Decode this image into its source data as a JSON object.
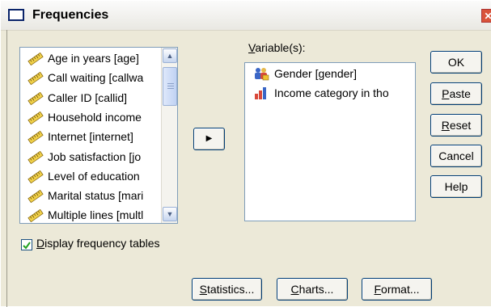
{
  "dialog": {
    "title": "Frequencies",
    "close_glyph": "✕"
  },
  "source_list": {
    "items": [
      {
        "label": "Age in years [age]",
        "icon": "scale-ruler-icon"
      },
      {
        "label": "Call waiting [callwa",
        "icon": "scale-ruler-icon"
      },
      {
        "label": "Caller ID [callid]",
        "icon": "scale-ruler-icon"
      },
      {
        "label": "Household income",
        "icon": "scale-ruler-icon"
      },
      {
        "label": "Internet [internet]",
        "icon": "scale-ruler-icon"
      },
      {
        "label": "Job satisfaction [jo",
        "icon": "scale-ruler-icon"
      },
      {
        "label": "Level of education",
        "icon": "scale-ruler-icon"
      },
      {
        "label": "Marital status [mari",
        "icon": "scale-ruler-icon"
      },
      {
        "label": "Multiple lines [multl",
        "icon": "scale-ruler-icon"
      }
    ],
    "scroll_up_glyph": "▲",
    "scroll_down_glyph": "▼"
  },
  "move_button": {
    "glyph": "▶"
  },
  "variables": {
    "label_first": "V",
    "label_rest": "ariable(s):",
    "items": [
      {
        "label": "Gender [gender]",
        "icon": "nominal-people-icon"
      },
      {
        "label": "Income category in tho",
        "icon": "ordinal-bars-icon"
      }
    ]
  },
  "side_buttons": {
    "ok": {
      "first": "",
      "mn": "",
      "rest": "OK"
    },
    "paste": {
      "first": "",
      "mn": "P",
      "rest": "aste"
    },
    "reset": {
      "first": "",
      "mn": "R",
      "rest": "eset"
    },
    "cancel": {
      "first": "",
      "mn": "",
      "rest": "Cancel"
    },
    "help": {
      "first": "",
      "mn": "",
      "rest": "Help"
    }
  },
  "checkbox": {
    "checked": true,
    "label_first": "D",
    "label_rest": "isplay frequency tables",
    "check_glyph": "✔"
  },
  "bottom_buttons": {
    "statistics": {
      "mn": "S",
      "rest": "tatistics..."
    },
    "charts": {
      "mn": "C",
      "rest": "harts..."
    },
    "format": {
      "mn": "F",
      "rest": "ormat..."
    }
  }
}
